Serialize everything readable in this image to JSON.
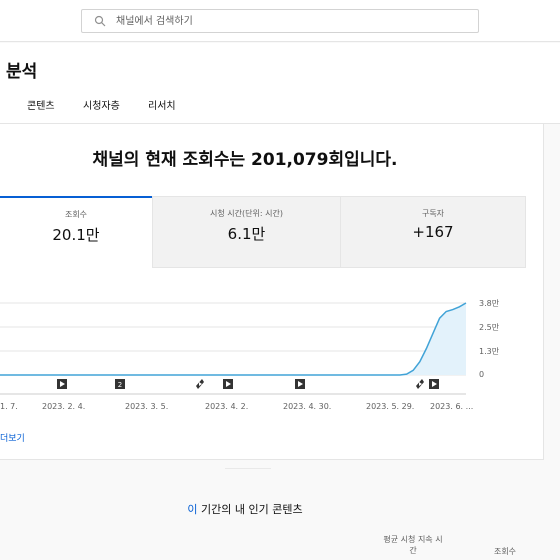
{
  "search": {
    "placeholder": "채널에서 검색하기"
  },
  "header": {
    "title": "분석",
    "tabs": [
      "콘텐츠",
      "시청자층",
      "리서치"
    ]
  },
  "overview": {
    "headline": "채널의 현재 조회수는 201,079회입니다.",
    "metrics": [
      {
        "label": "조회수",
        "value": "20.1만"
      },
      {
        "label": "시청 시간(단위: 시간)",
        "value": "6.1만"
      },
      {
        "label": "구독자",
        "value": "+167"
      }
    ]
  },
  "chart_data": {
    "type": "line",
    "x_tick_labels": [
      "1. 7.",
      "2023. 2. 4.",
      "2023. 3. 5.",
      "2023. 4. 2.",
      "2023. 4. 30.",
      "2023. 5. 29.",
      "2023. 6. ..."
    ],
    "y_tick_labels": [
      "3.8만",
      "2.5만",
      "1.3만",
      "0"
    ],
    "ylim": [
      0,
      38000
    ],
    "grid": true,
    "series": [
      {
        "values": [
          0,
          0,
          0,
          0,
          0,
          0,
          0,
          0,
          0,
          0,
          0,
          0,
          0,
          0,
          0,
          0,
          500,
          2500,
          7000,
          14000,
          22000,
          30000,
          33500,
          34500,
          36000,
          38000
        ]
      }
    ],
    "markers": [
      "play",
      "2",
      "short",
      "play",
      "play",
      "short",
      "play"
    ],
    "colors": {
      "line": "#41a3d7",
      "fill": "#e3f2fb",
      "grid": "#e5e5e5",
      "marker": "#333333"
    }
  },
  "more_link": "더보기",
  "top_content": {
    "title_accent": "이",
    "title_rest": " 기간의 내 인기 콘텐츠",
    "col_avg_line1": "평균 시청 지속 시",
    "col_avg_line2": "간",
    "col_views": "조회수"
  },
  "colors": {
    "accent": "#065fd4"
  }
}
